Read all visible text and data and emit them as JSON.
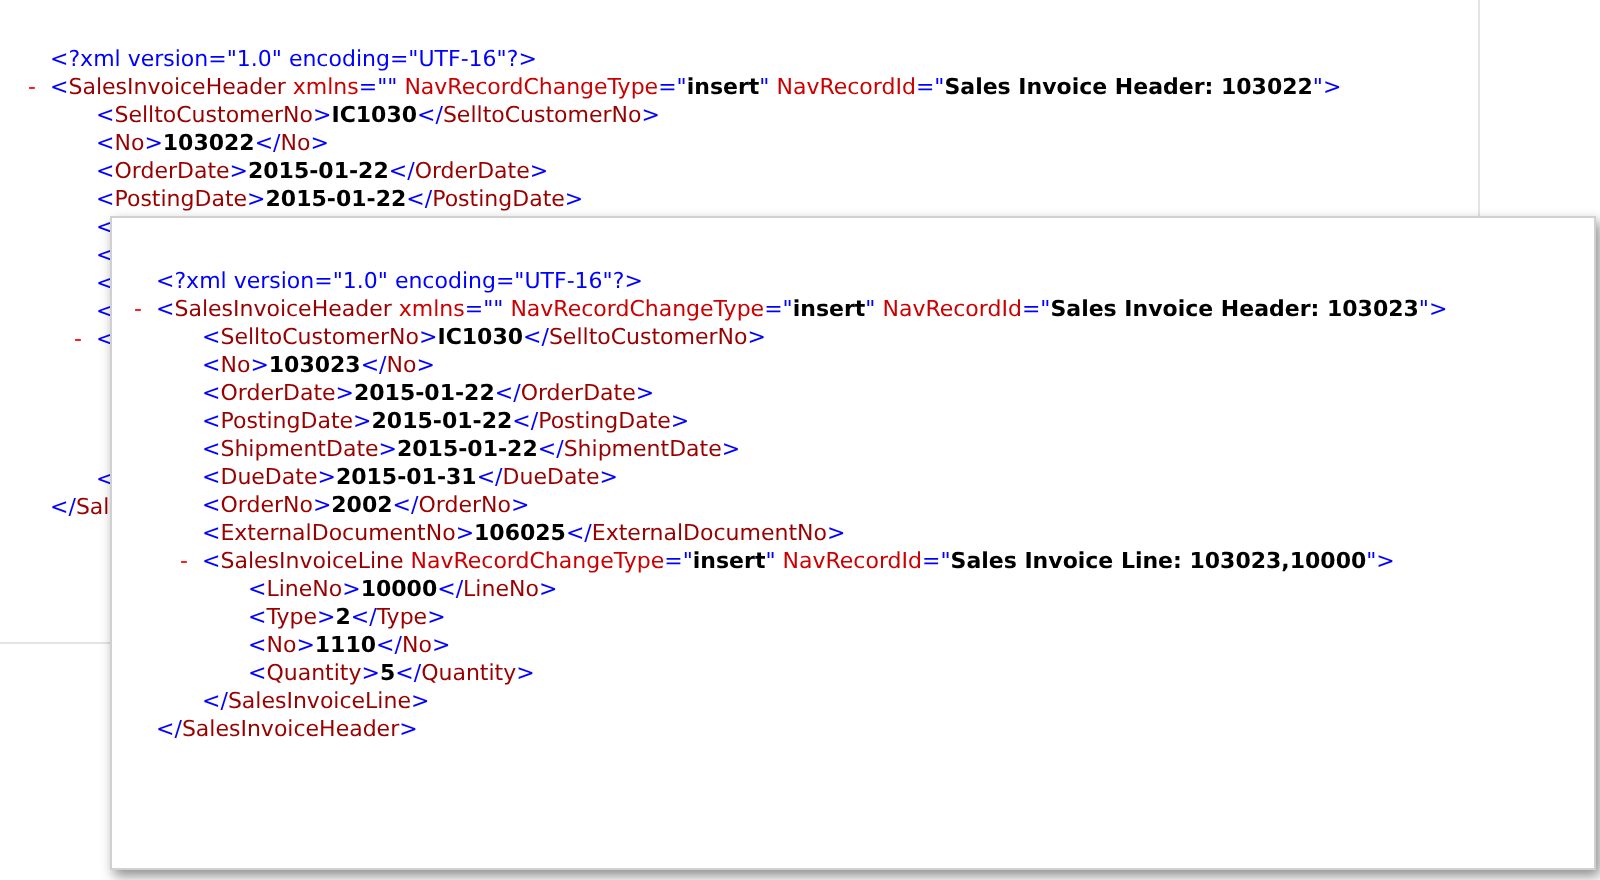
{
  "windows": [
    {
      "lines": [
        {
          "tokens": [
            {
              "kind": "markup",
              "text": "<?xml version=\"1.0\" encoding=\"UTF-16\"?>"
            }
          ]
        },
        {
          "toggle": "-",
          "tokens": [
            {
              "kind": "markup",
              "text": "<"
            },
            {
              "kind": "tag",
              "text": "SalesInvoiceHeader "
            },
            {
              "kind": "attribute",
              "text": "xmlns"
            },
            {
              "kind": "markup",
              "text": "=\"\" "
            },
            {
              "kind": "attribute",
              "text": "NavRecordChangeType"
            },
            {
              "kind": "markup",
              "text": "=\""
            },
            {
              "kind": "value",
              "text": "insert"
            },
            {
              "kind": "markup",
              "text": "\" "
            },
            {
              "kind": "attribute",
              "text": "NavRecordId"
            },
            {
              "kind": "markup",
              "text": "=\""
            },
            {
              "kind": "value",
              "text": "Sales Invoice Header: 103022"
            },
            {
              "kind": "markup",
              "text": "\">"
            }
          ],
          "children": [
            {
              "tokens": [
                {
                  "kind": "markup",
                  "text": "<"
                },
                {
                  "kind": "tag",
                  "text": "SelltoCustomerNo"
                },
                {
                  "kind": "markup",
                  "text": ">"
                },
                {
                  "kind": "value",
                  "text": "IC1030"
                },
                {
                  "kind": "markup",
                  "text": "</"
                },
                {
                  "kind": "tag",
                  "text": "SelltoCustomerNo"
                },
                {
                  "kind": "markup",
                  "text": ">"
                }
              ]
            },
            {
              "tokens": [
                {
                  "kind": "markup",
                  "text": "<"
                },
                {
                  "kind": "tag",
                  "text": "No"
                },
                {
                  "kind": "markup",
                  "text": ">"
                },
                {
                  "kind": "value",
                  "text": "103022"
                },
                {
                  "kind": "markup",
                  "text": "</"
                },
                {
                  "kind": "tag",
                  "text": "No"
                },
                {
                  "kind": "markup",
                  "text": ">"
                }
              ]
            },
            {
              "tokens": [
                {
                  "kind": "markup",
                  "text": "<"
                },
                {
                  "kind": "tag",
                  "text": "OrderDate"
                },
                {
                  "kind": "markup",
                  "text": ">"
                },
                {
                  "kind": "value",
                  "text": "2015-01-22"
                },
                {
                  "kind": "markup",
                  "text": "</"
                },
                {
                  "kind": "tag",
                  "text": "OrderDate"
                },
                {
                  "kind": "markup",
                  "text": ">"
                }
              ]
            },
            {
              "tokens": [
                {
                  "kind": "markup",
                  "text": "<"
                },
                {
                  "kind": "tag",
                  "text": "PostingDate"
                },
                {
                  "kind": "markup",
                  "text": ">"
                },
                {
                  "kind": "value",
                  "text": "2015-01-22"
                },
                {
                  "kind": "markup",
                  "text": "</"
                },
                {
                  "kind": "tag",
                  "text": "PostingDate"
                },
                {
                  "kind": "markup",
                  "text": ">"
                }
              ]
            },
            {
              "tokens": [
                {
                  "kind": "markup",
                  "text": "<"
                }
              ]
            },
            {
              "tokens": [
                {
                  "kind": "markup",
                  "text": "<"
                }
              ]
            },
            {
              "tokens": [
                {
                  "kind": "markup",
                  "text": "<"
                }
              ]
            },
            {
              "tokens": [
                {
                  "kind": "markup",
                  "text": "<"
                }
              ]
            },
            {
              "toggle": "-",
              "tokens": [
                {
                  "kind": "markup",
                  "text": "<"
                }
              ],
              "close": [
                {
                  "kind": "markup",
                  "text": "<"
                }
              ]
            }
          ],
          "close": [
            {
              "kind": "markup",
              "text": "</"
            },
            {
              "kind": "tag",
              "text": "Sal"
            }
          ]
        }
      ]
    },
    {
      "lines": [
        {
          "tokens": [
            {
              "kind": "markup",
              "text": "<?xml version=\"1.0\" encoding=\"UTF-16\"?>"
            }
          ]
        },
        {
          "toggle": "-",
          "tokens": [
            {
              "kind": "markup",
              "text": "<"
            },
            {
              "kind": "tag",
              "text": "SalesInvoiceHeader "
            },
            {
              "kind": "attribute",
              "text": "xmlns"
            },
            {
              "kind": "markup",
              "text": "=\"\" "
            },
            {
              "kind": "attribute",
              "text": "NavRecordChangeType"
            },
            {
              "kind": "markup",
              "text": "=\""
            },
            {
              "kind": "value",
              "text": "insert"
            },
            {
              "kind": "markup",
              "text": "\" "
            },
            {
              "kind": "attribute",
              "text": "NavRecordId"
            },
            {
              "kind": "markup",
              "text": "=\""
            },
            {
              "kind": "value",
              "text": "Sales Invoice Header: 103023"
            },
            {
              "kind": "markup",
              "text": "\">"
            }
          ],
          "children": [
            {
              "tokens": [
                {
                  "kind": "markup",
                  "text": "<"
                },
                {
                  "kind": "tag",
                  "text": "SelltoCustomerNo"
                },
                {
                  "kind": "markup",
                  "text": ">"
                },
                {
                  "kind": "value",
                  "text": "IC1030"
                },
                {
                  "kind": "markup",
                  "text": "</"
                },
                {
                  "kind": "tag",
                  "text": "SelltoCustomerNo"
                },
                {
                  "kind": "markup",
                  "text": ">"
                }
              ]
            },
            {
              "tokens": [
                {
                  "kind": "markup",
                  "text": "<"
                },
                {
                  "kind": "tag",
                  "text": "No"
                },
                {
                  "kind": "markup",
                  "text": ">"
                },
                {
                  "kind": "value",
                  "text": "103023"
                },
                {
                  "kind": "markup",
                  "text": "</"
                },
                {
                  "kind": "tag",
                  "text": "No"
                },
                {
                  "kind": "markup",
                  "text": ">"
                }
              ]
            },
            {
              "tokens": [
                {
                  "kind": "markup",
                  "text": "<"
                },
                {
                  "kind": "tag",
                  "text": "OrderDate"
                },
                {
                  "kind": "markup",
                  "text": ">"
                },
                {
                  "kind": "value",
                  "text": "2015-01-22"
                },
                {
                  "kind": "markup",
                  "text": "</"
                },
                {
                  "kind": "tag",
                  "text": "OrderDate"
                },
                {
                  "kind": "markup",
                  "text": ">"
                }
              ]
            },
            {
              "tokens": [
                {
                  "kind": "markup",
                  "text": "<"
                },
                {
                  "kind": "tag",
                  "text": "PostingDate"
                },
                {
                  "kind": "markup",
                  "text": ">"
                },
                {
                  "kind": "value",
                  "text": "2015-01-22"
                },
                {
                  "kind": "markup",
                  "text": "</"
                },
                {
                  "kind": "tag",
                  "text": "PostingDate"
                },
                {
                  "kind": "markup",
                  "text": ">"
                }
              ]
            },
            {
              "tokens": [
                {
                  "kind": "markup",
                  "text": "<"
                },
                {
                  "kind": "tag",
                  "text": "ShipmentDate"
                },
                {
                  "kind": "markup",
                  "text": ">"
                },
                {
                  "kind": "value",
                  "text": "2015-01-22"
                },
                {
                  "kind": "markup",
                  "text": "</"
                },
                {
                  "kind": "tag",
                  "text": "ShipmentDate"
                },
                {
                  "kind": "markup",
                  "text": ">"
                }
              ]
            },
            {
              "tokens": [
                {
                  "kind": "markup",
                  "text": "<"
                },
                {
                  "kind": "tag",
                  "text": "DueDate"
                },
                {
                  "kind": "markup",
                  "text": ">"
                },
                {
                  "kind": "value",
                  "text": "2015-01-31"
                },
                {
                  "kind": "markup",
                  "text": "</"
                },
                {
                  "kind": "tag",
                  "text": "DueDate"
                },
                {
                  "kind": "markup",
                  "text": ">"
                }
              ]
            },
            {
              "tokens": [
                {
                  "kind": "markup",
                  "text": "<"
                },
                {
                  "kind": "tag",
                  "text": "OrderNo"
                },
                {
                  "kind": "markup",
                  "text": ">"
                },
                {
                  "kind": "value",
                  "text": "2002"
                },
                {
                  "kind": "markup",
                  "text": "</"
                },
                {
                  "kind": "tag",
                  "text": "OrderNo"
                },
                {
                  "kind": "markup",
                  "text": ">"
                }
              ]
            },
            {
              "tokens": [
                {
                  "kind": "markup",
                  "text": "<"
                },
                {
                  "kind": "tag",
                  "text": "ExternalDocumentNo"
                },
                {
                  "kind": "markup",
                  "text": ">"
                },
                {
                  "kind": "value",
                  "text": "106025"
                },
                {
                  "kind": "markup",
                  "text": "</"
                },
                {
                  "kind": "tag",
                  "text": "ExternalDocumentNo"
                },
                {
                  "kind": "markup",
                  "text": ">"
                }
              ]
            },
            {
              "toggle": "-",
              "tokens": [
                {
                  "kind": "markup",
                  "text": "<"
                },
                {
                  "kind": "tag",
                  "text": "SalesInvoiceLine "
                },
                {
                  "kind": "attribute",
                  "text": "NavRecordChangeType"
                },
                {
                  "kind": "markup",
                  "text": "=\""
                },
                {
                  "kind": "value",
                  "text": "insert"
                },
                {
                  "kind": "markup",
                  "text": "\" "
                },
                {
                  "kind": "attribute",
                  "text": "NavRecordId"
                },
                {
                  "kind": "markup",
                  "text": "=\""
                },
                {
                  "kind": "value",
                  "text": "Sales Invoice Line: 103023,10000"
                },
                {
                  "kind": "markup",
                  "text": "\">"
                }
              ],
              "children": [
                {
                  "tokens": [
                    {
                      "kind": "markup",
                      "text": "<"
                    },
                    {
                      "kind": "tag",
                      "text": "LineNo"
                    },
                    {
                      "kind": "markup",
                      "text": ">"
                    },
                    {
                      "kind": "value",
                      "text": "10000"
                    },
                    {
                      "kind": "markup",
                      "text": "</"
                    },
                    {
                      "kind": "tag",
                      "text": "LineNo"
                    },
                    {
                      "kind": "markup",
                      "text": ">"
                    }
                  ]
                },
                {
                  "tokens": [
                    {
                      "kind": "markup",
                      "text": "<"
                    },
                    {
                      "kind": "tag",
                      "text": "Type"
                    },
                    {
                      "kind": "markup",
                      "text": ">"
                    },
                    {
                      "kind": "value",
                      "text": "2"
                    },
                    {
                      "kind": "markup",
                      "text": "</"
                    },
                    {
                      "kind": "tag",
                      "text": "Type"
                    },
                    {
                      "kind": "markup",
                      "text": ">"
                    }
                  ]
                },
                {
                  "tokens": [
                    {
                      "kind": "markup",
                      "text": "<"
                    },
                    {
                      "kind": "tag",
                      "text": "No"
                    },
                    {
                      "kind": "markup",
                      "text": ">"
                    },
                    {
                      "kind": "value",
                      "text": "1110"
                    },
                    {
                      "kind": "markup",
                      "text": "</"
                    },
                    {
                      "kind": "tag",
                      "text": "No"
                    },
                    {
                      "kind": "markup",
                      "text": ">"
                    }
                  ]
                },
                {
                  "tokens": [
                    {
                      "kind": "markup",
                      "text": "<"
                    },
                    {
                      "kind": "tag",
                      "text": "Quantity"
                    },
                    {
                      "kind": "markup",
                      "text": ">"
                    },
                    {
                      "kind": "value",
                      "text": "5"
                    },
                    {
                      "kind": "markup",
                      "text": "</"
                    },
                    {
                      "kind": "tag",
                      "text": "Quantity"
                    },
                    {
                      "kind": "markup",
                      "text": ">"
                    }
                  ]
                }
              ],
              "close": [
                {
                  "kind": "markup",
                  "text": "</"
                },
                {
                  "kind": "tag",
                  "text": "SalesInvoiceLine"
                },
                {
                  "kind": "markup",
                  "text": ">"
                }
              ]
            }
          ],
          "close": [
            {
              "kind": "markup",
              "text": "</"
            },
            {
              "kind": "tag",
              "text": "SalesInvoiceHeader"
            },
            {
              "kind": "markup",
              "text": ">"
            }
          ]
        }
      ]
    }
  ]
}
